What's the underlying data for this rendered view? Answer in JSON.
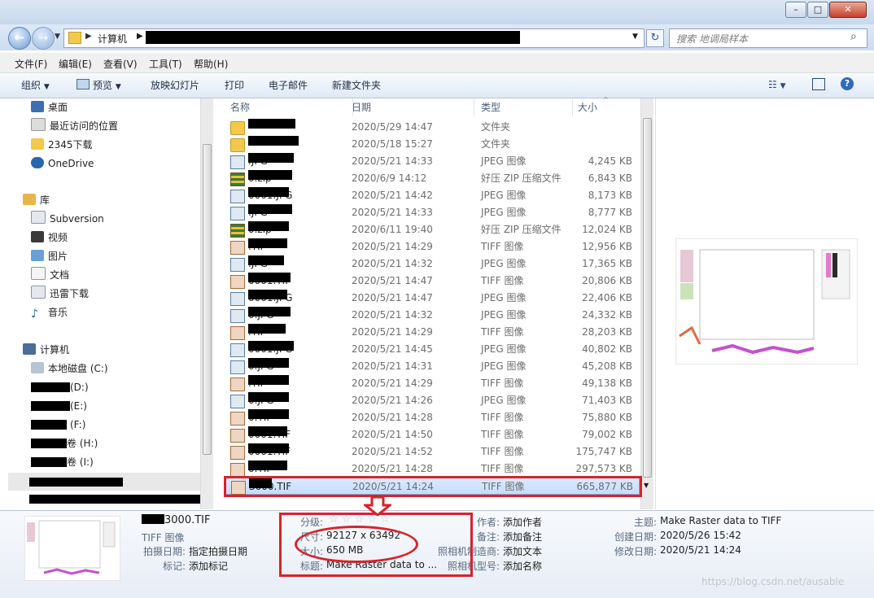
{
  "address": {
    "root": "计算机",
    "search_placeholder": "搜索 地调局样本"
  },
  "menu": [
    "文件(F)",
    "编辑(E)",
    "查看(V)",
    "工具(T)",
    "帮助(H)"
  ],
  "toolbar": {
    "organize": "组织",
    "preview": "预览",
    "slideshow": "放映幻灯片",
    "print": "打印",
    "email": "电子邮件",
    "new_folder": "新建文件夹"
  },
  "nav": {
    "favorites": [
      "桌面",
      "最近访问的位置",
      "2345下载",
      "OneDrive"
    ],
    "library_title": "库",
    "libraries": [
      "Subversion",
      "视频",
      "图片",
      "文档",
      "迅雷下载",
      "音乐"
    ],
    "computer_title": "计算机",
    "drives": [
      "本地磁盘 (C:)",
      "(D:)",
      "(E:)",
      "(F:)",
      "卷 (H:)",
      "卷 (I:)"
    ]
  },
  "columns": {
    "name": "名称",
    "date": "日期",
    "type": "类型",
    "size": "大小"
  },
  "files": [
    {
      "name": "",
      "date": "2020/5/29 14:47",
      "type": "文件夹",
      "size": "",
      "icon": "folder"
    },
    {
      "name": "",
      "date": "2020/5/18 15:27",
      "type": "文件夹",
      "size": "",
      "icon": "folder"
    },
    {
      "name": ".JPG",
      "date": "2020/5/21 14:33",
      "type": "JPEG 图像",
      "size": "4,245 KB",
      "icon": "jpg"
    },
    {
      "name": "0.zip",
      "date": "2020/6/9 14:12",
      "type": "好压 ZIP 压缩文件",
      "size": "6,843 KB",
      "icon": "zip"
    },
    {
      "name": "0001.JPG",
      "date": "2020/5/21 14:42",
      "type": "JPEG 图像",
      "size": "8,173 KB",
      "icon": "jpg"
    },
    {
      "name": ".JPG",
      "date": "2020/5/21 14:33",
      "type": "JPEG 图像",
      "size": "8,777 KB",
      "icon": "jpg"
    },
    {
      "name": "0.zip",
      "date": "2020/6/11 19:40",
      "type": "好压 ZIP 压缩文件",
      "size": "12,024 KB",
      "icon": "zip"
    },
    {
      "name": ".TIF",
      "date": "2020/5/21 14:29",
      "type": "TIFF 图像",
      "size": "12,956 KB",
      "icon": "tif"
    },
    {
      "name": ".JPG",
      "date": "2020/5/21 14:32",
      "type": "JPEG 图像",
      "size": "17,365 KB",
      "icon": "jpg"
    },
    {
      "name": "0001.TIF",
      "date": "2020/5/21 14:47",
      "type": "TIFF 图像",
      "size": "20,806 KB",
      "icon": "tif"
    },
    {
      "name": "0001.JPG",
      "date": "2020/5/21 14:47",
      "type": "JPEG 图像",
      "size": "22,406 KB",
      "icon": "jpg"
    },
    {
      "name": "0.JPG",
      "date": "2020/5/21 14:32",
      "type": "JPEG 图像",
      "size": "24,332 KB",
      "icon": "jpg"
    },
    {
      "name": ".TIF",
      "date": "2020/5/21 14:29",
      "type": "TIFF 图像",
      "size": "28,203 KB",
      "icon": "tif"
    },
    {
      "name": "0001.JPG",
      "date": "2020/5/21 14:45",
      "type": "JPEG 图像",
      "size": "40,802 KB",
      "icon": "jpg"
    },
    {
      "name": "0.JPG",
      "date": "2020/5/21 14:31",
      "type": "JPEG 图像",
      "size": "45,208 KB",
      "icon": "jpg"
    },
    {
      "name": ".TIF",
      "date": "2020/5/21 14:29",
      "type": "TIFF 图像",
      "size": "49,138 KB",
      "icon": "tif"
    },
    {
      "name": "0.JPG",
      "date": "2020/5/21 14:26",
      "type": "JPEG 图像",
      "size": "71,403 KB",
      "icon": "jpg"
    },
    {
      "name": "0.TIF",
      "date": "2020/5/21 14:28",
      "type": "TIFF 图像",
      "size": "75,880 KB",
      "icon": "tif"
    },
    {
      "name": "0001.TIF",
      "date": "2020/5/21 14:50",
      "type": "TIFF 图像",
      "size": "79,002 KB",
      "icon": "tif"
    },
    {
      "name": "0001.TIF",
      "date": "2020/5/21 14:52",
      "type": "TIFF 图像",
      "size": "175,747 KB",
      "icon": "tif"
    },
    {
      "name": "0.TIF",
      "date": "2020/5/21 14:28",
      "type": "TIFF 图像",
      "size": "297,573 KB",
      "icon": "tif"
    },
    {
      "name": "3000.TIF",
      "date": "2020/5/21 14:24",
      "type": "TIFF 图像",
      "size": "665,877 KB",
      "icon": "tif",
      "selected": true
    }
  ],
  "details": {
    "filename": "3000.TIF",
    "filetype": "TIFF 图像",
    "shot_date_label": "拍摄日期:",
    "shot_date": "指定拍摄日期",
    "tags_label": "标记:",
    "tags": "添加标记",
    "rating_label": "分级:",
    "dims_label": "尺寸:",
    "dims": "92127 x 63492",
    "size_label": "大小:",
    "size": "650 MB",
    "title_label": "标题:",
    "title": "Make Raster data to ...",
    "author_label": "作者:",
    "author": "添加作者",
    "remark_label": "备注:",
    "remark": "添加备注",
    "maker_label": "照相机制造商:",
    "maker": "添加文本",
    "model_label": "照相机型号:",
    "model": "添加名称",
    "subject_label": "主题:",
    "subject": "Make Raster data to TIFF",
    "created_label": "创建日期:",
    "created": "2020/5/26 15:42",
    "modified_label": "修改日期:",
    "modified": "2020/5/21 14:24"
  },
  "watermark": "https://blog.csdn.net/ausable"
}
